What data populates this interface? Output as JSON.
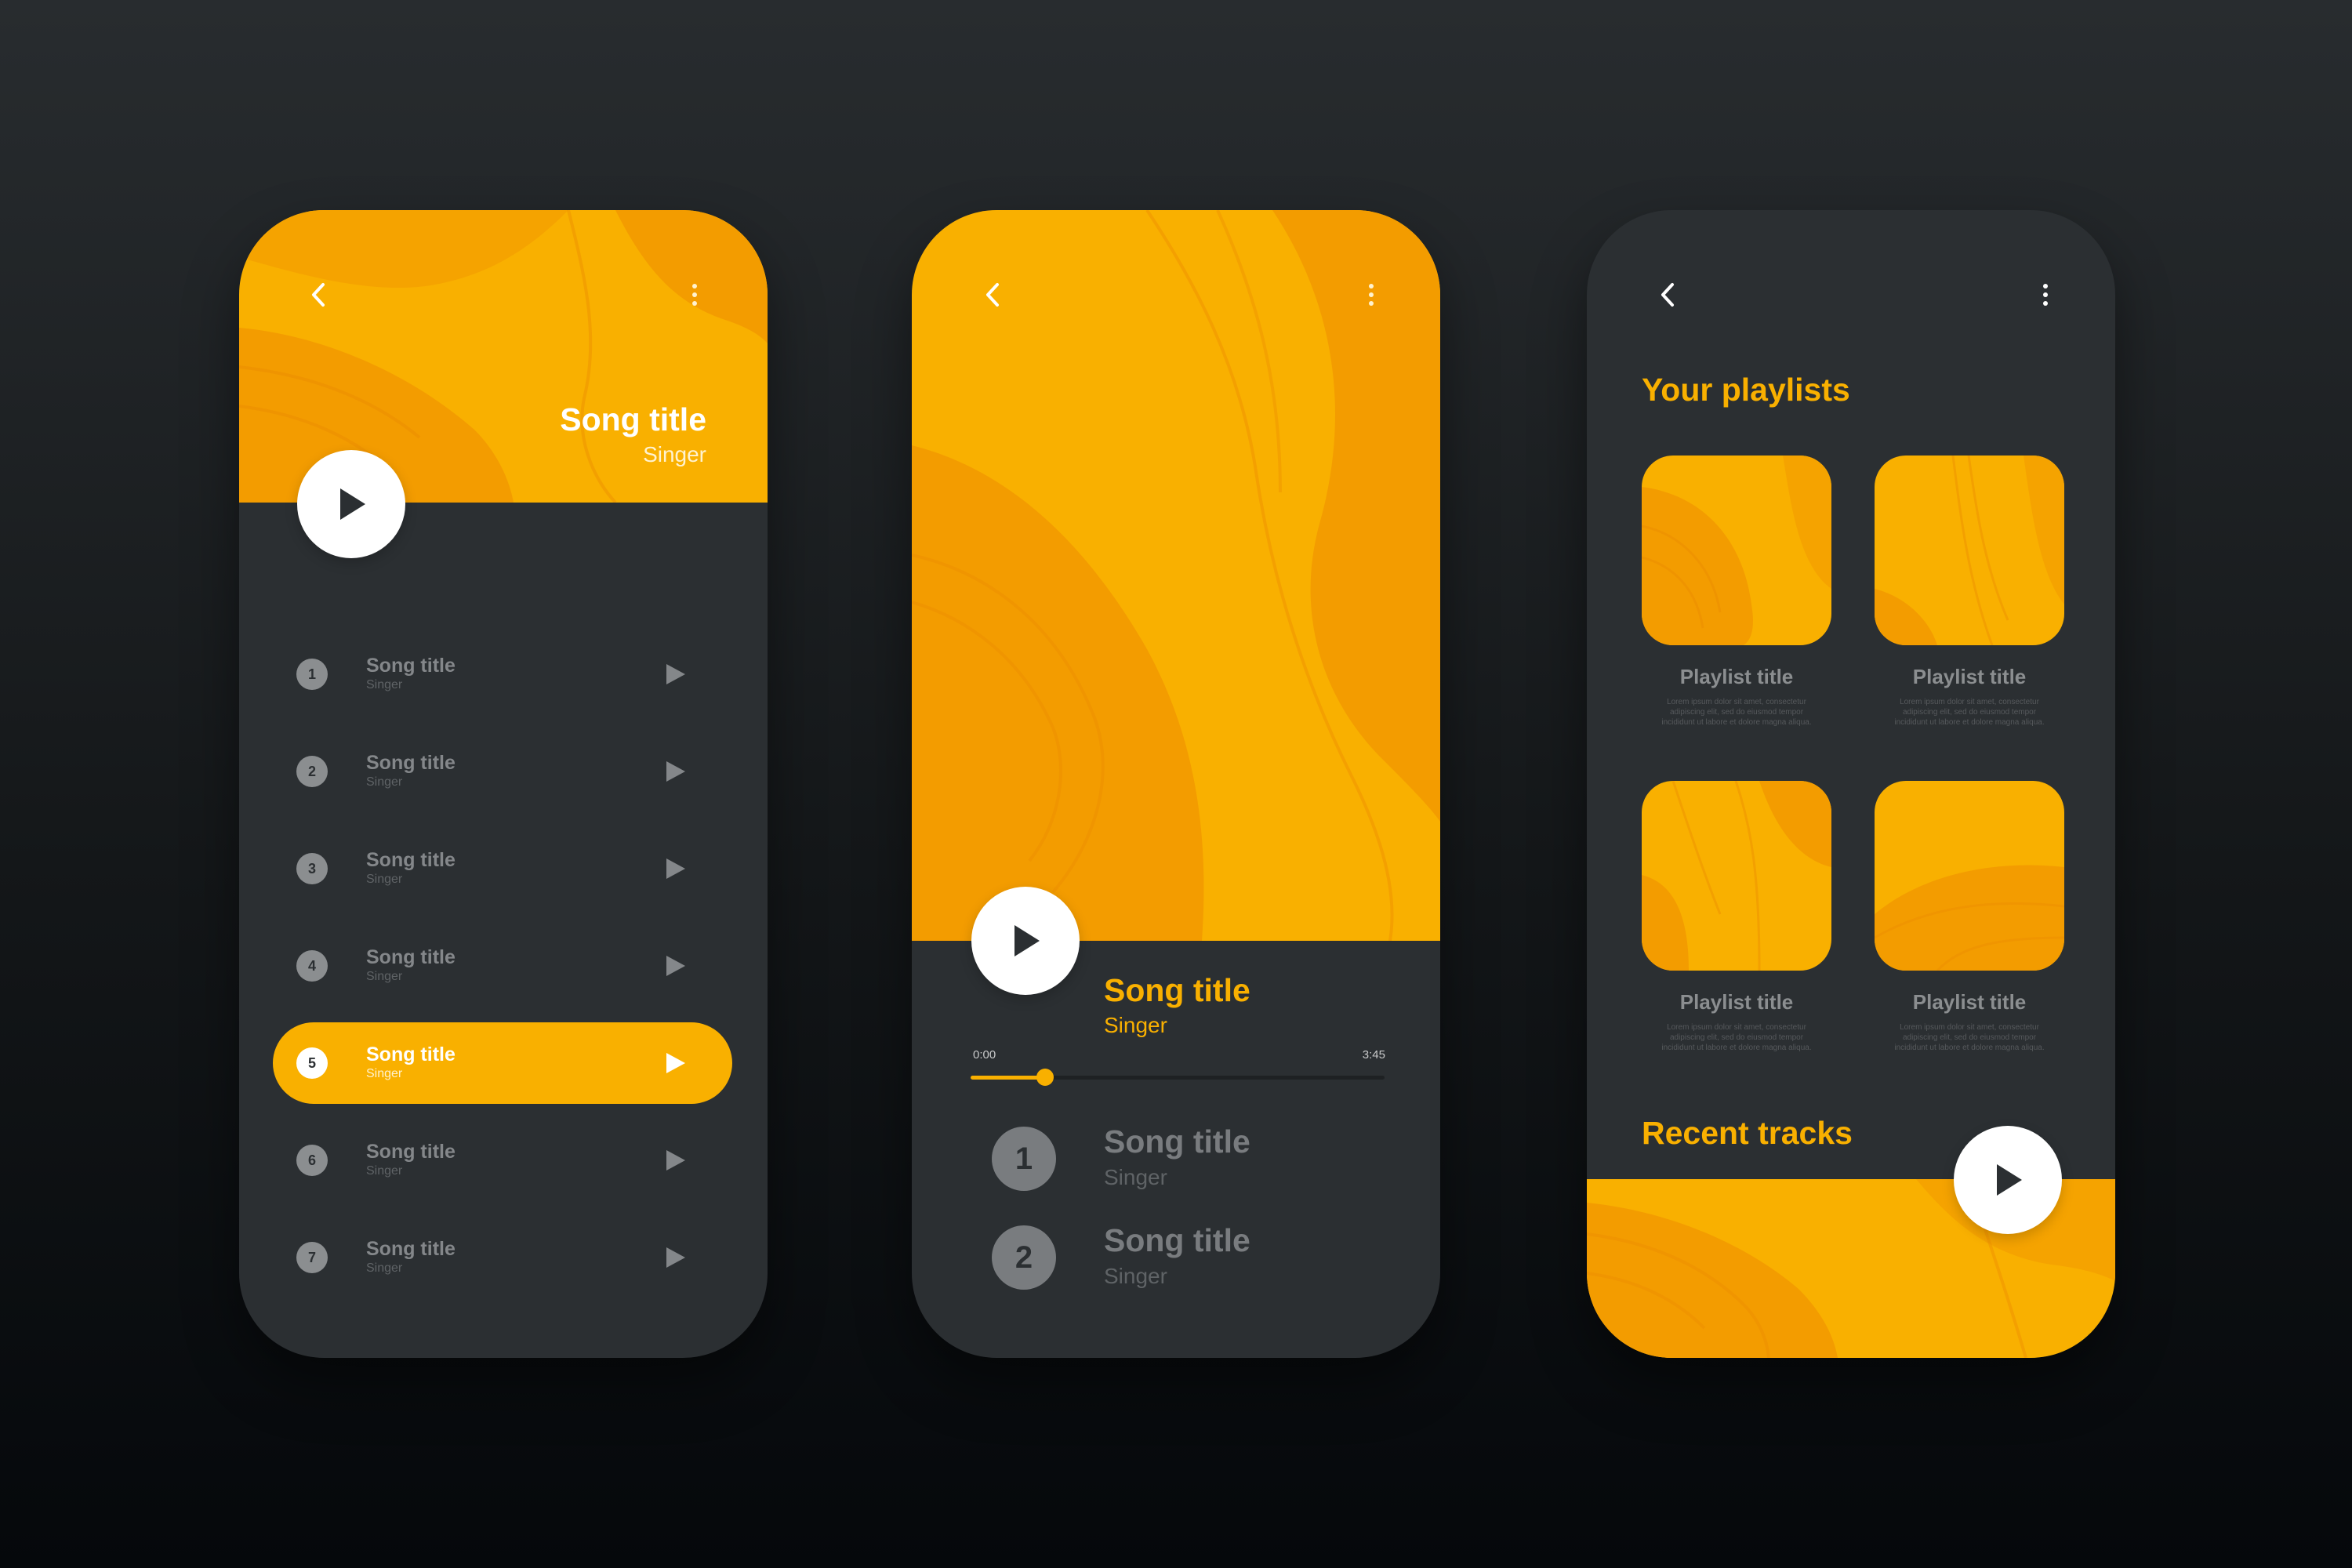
{
  "colors": {
    "accent": "#f9b000",
    "accent_dark": "#f39c00",
    "phone_body": "#2b2f32",
    "muted_text": "#84878a"
  },
  "player_list": {
    "header": {
      "song_title": "Song title",
      "singer": "Singer"
    },
    "tracks": [
      {
        "num": "1",
        "title": "Song title",
        "singer": "Singer",
        "active": false
      },
      {
        "num": "2",
        "title": "Song title",
        "singer": "Singer",
        "active": false
      },
      {
        "num": "3",
        "title": "Song title",
        "singer": "Singer",
        "active": false
      },
      {
        "num": "4",
        "title": "Song title",
        "singer": "Singer",
        "active": false
      },
      {
        "num": "5",
        "title": "Song title",
        "singer": "Singer",
        "active": true
      },
      {
        "num": "6",
        "title": "Song title",
        "singer": "Singer",
        "active": false
      },
      {
        "num": "7",
        "title": "Song title",
        "singer": "Singer",
        "active": false
      }
    ]
  },
  "now_playing": {
    "song_title": "Song title",
    "singer": "Singer",
    "time_elapsed": "0:00",
    "time_total": "3:45",
    "progress_fraction": 0.18,
    "queue": [
      {
        "num": "1",
        "title": "Song title",
        "singer": "Singer"
      },
      {
        "num": "2",
        "title": "Song title",
        "singer": "Singer"
      }
    ]
  },
  "library": {
    "playlists_heading": "Your playlists",
    "playlists": [
      {
        "title": "Playlist title",
        "desc": "Lorem ipsum dolor sit amet, consectetur adipiscing elit, sed do eiusmod tempor incididunt ut labore et dolore magna aliqua."
      },
      {
        "title": "Playlist title",
        "desc": "Lorem ipsum dolor sit amet, consectetur adipiscing elit, sed do eiusmod tempor incididunt ut labore et dolore magna aliqua."
      },
      {
        "title": "Playlist title",
        "desc": "Lorem ipsum dolor sit amet, consectetur adipiscing elit, sed do eiusmod tempor incididunt ut labore et dolore magna aliqua."
      },
      {
        "title": "Playlist title",
        "desc": "Lorem ipsum dolor sit amet, consectetur adipiscing elit, sed do eiusmod tempor incididunt ut labore et dolore magna aliqua."
      }
    ],
    "recent_heading": "Recent tracks"
  },
  "icons": {
    "back": "chevron-left-icon",
    "menu": "more-vertical-icon",
    "play": "play-icon"
  }
}
